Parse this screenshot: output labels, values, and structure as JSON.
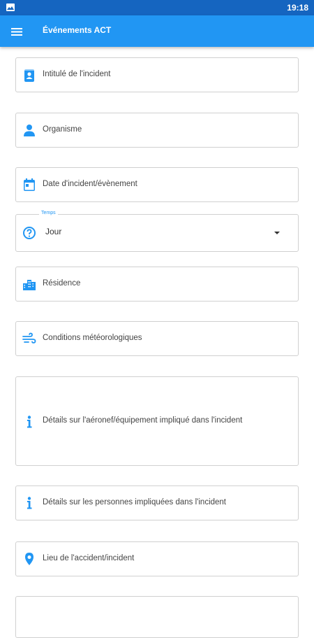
{
  "status_bar": {
    "time": "19:18"
  },
  "app_bar": {
    "title": "Événements ACT",
    "menu_icon": "menu-icon"
  },
  "form": {
    "incident_title_label": "Intitulé de l'incident",
    "organism_label": "Organisme",
    "date_label": "Date d'incident/évènement",
    "weather_time": {
      "legend": "Temps",
      "value": "Jour"
    },
    "residence_label": "Résidence",
    "weather_conditions_label": "Conditions météorologiques",
    "aircraft_details_label": "Détails sur l'aéronef/équipement impliqué dans l'incident",
    "persons_details_label": "Détails sur les personnes impliquées dans l'incident",
    "location_label": "Lieu de l'accident/incident"
  },
  "colors": {
    "primary": "#2196f3",
    "status": "#1565c0",
    "border": "#d0d0d0"
  }
}
